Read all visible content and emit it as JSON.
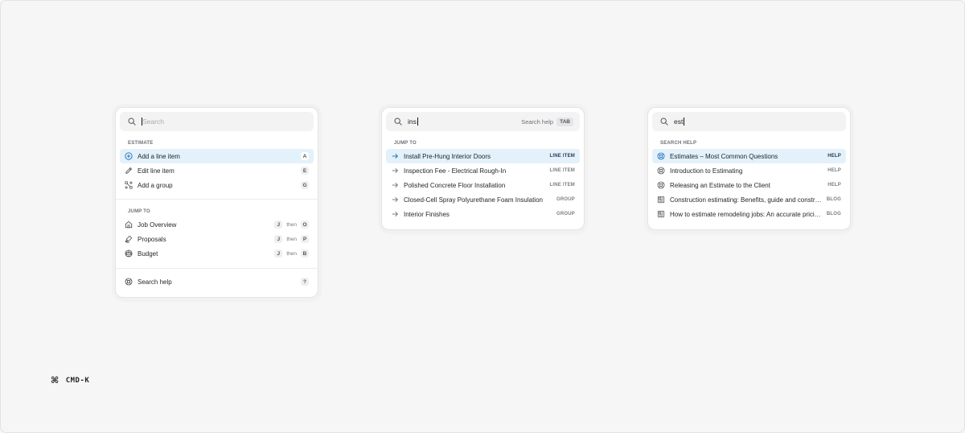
{
  "palette1": {
    "search": {
      "placeholder": "Search"
    },
    "estimate_section": {
      "label": "ESTIMATE",
      "items": [
        {
          "label": "Add a line item",
          "key": "A",
          "icon": "plus-circle-icon"
        },
        {
          "label": "Edit line item",
          "key": "E",
          "icon": "pencil-icon"
        },
        {
          "label": "Add a group",
          "key": "G",
          "icon": "group-icon"
        }
      ]
    },
    "jump_section": {
      "label": "JUMP TO",
      "then": "then",
      "items": [
        {
          "label": "Job Overview",
          "key1": "J",
          "key2": "O",
          "icon": "home-icon"
        },
        {
          "label": "Proposals",
          "key1": "J",
          "key2": "P",
          "icon": "pen-nib-icon"
        },
        {
          "label": "Budget",
          "key1": "J",
          "key2": "B",
          "icon": "scale-icon"
        }
      ]
    },
    "help": {
      "label": "Search help",
      "key": "?",
      "icon": "lifebuoy-icon"
    }
  },
  "palette2": {
    "search": {
      "value": "ins",
      "hint": "Search help",
      "hint_key": "TAB"
    },
    "section": {
      "label": "JUMP TO",
      "items": [
        {
          "label": "Install Pre-Hung Interior Doors",
          "tag": "LINE ITEM"
        },
        {
          "label": "Inspection Fee - Electrical Rough-In",
          "tag": "LINE ITEM"
        },
        {
          "label": "Polished Concrete Floor Installation",
          "tag": "LINE ITEM"
        },
        {
          "label": "Closed-Cell Spray Polyurethane Foam Insulation",
          "tag": "GROUP"
        },
        {
          "label": "Interior Finishes",
          "tag": "GROUP"
        }
      ]
    }
  },
  "palette3": {
    "search": {
      "value": "est"
    },
    "section": {
      "label": "SEARCH HELP",
      "items": [
        {
          "label": "Estimates – Most Common Questions",
          "tag": "HELP",
          "icon": "lifebuoy-icon"
        },
        {
          "label": "Introduction to Estimating",
          "tag": "HELP",
          "icon": "lifebuoy-icon"
        },
        {
          "label": "Releasing an Estimate to the Client",
          "tag": "HELP",
          "icon": "lifebuoy-icon"
        },
        {
          "label": "Construction estimating: Benefits, guide and construction",
          "tag": "BLOG",
          "icon": "newspaper-icon"
        },
        {
          "label": "How to estimate remodeling jobs: An accurate pricing guide",
          "tag": "BLOG",
          "icon": "newspaper-icon"
        }
      ]
    }
  },
  "footer": {
    "label": "CMD-K",
    "icon": "command-icon"
  },
  "colors": {
    "active_row": "#e3f1fb",
    "accent": "#1b6fb5"
  }
}
